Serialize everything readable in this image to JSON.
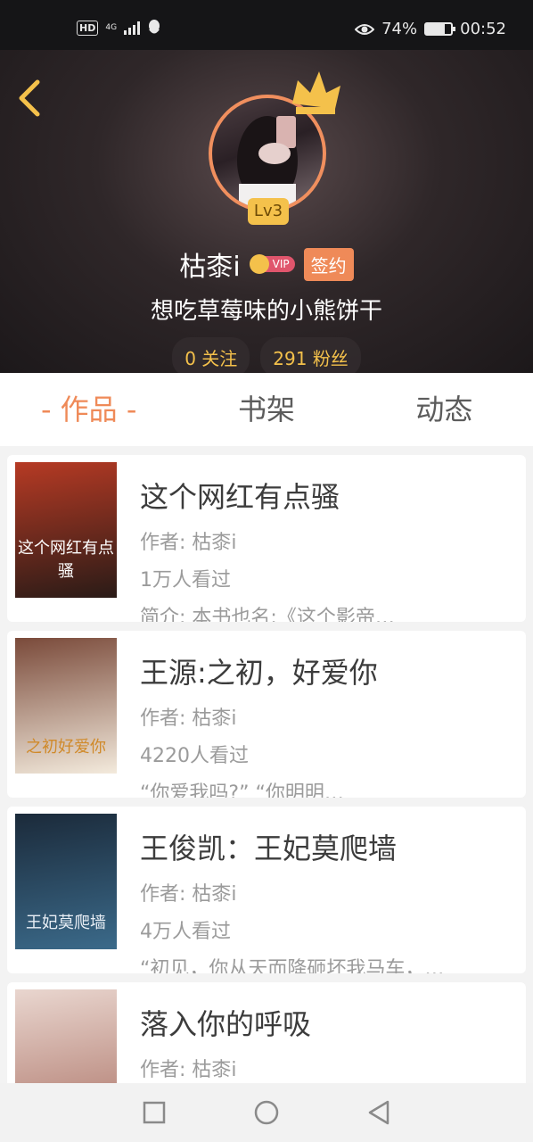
{
  "status_bar": {
    "hd": "HD",
    "network": "4G",
    "battery_percent": "74%",
    "battery_level": 74,
    "time": "00:52"
  },
  "profile": {
    "level": "Lv3",
    "name": "枯桼i",
    "vip_label": "VIP",
    "signed_label": "签约",
    "motto": "想吃草莓味的小熊饼干",
    "following": "0 关注",
    "followers": "291 粉丝"
  },
  "tabs": [
    {
      "label": "- 作品 -",
      "active": true
    },
    {
      "label": "书架",
      "active": false
    },
    {
      "label": "动态",
      "active": false
    }
  ],
  "books": [
    {
      "title": "这个网红有点骚",
      "author": "作者: 枯桼i",
      "views": "1万人看过",
      "summary": "简介: 本书也名:《这个影帝…",
      "cover_text": "这个网红有点骚",
      "cover_colors": [
        "#b63a24",
        "#2a1b17"
      ]
    },
    {
      "title": "王源:之初，好爱你",
      "author": "作者: 枯桼i",
      "views": "4220人看过",
      "summary": "“你爱我吗?” “你明明…",
      "cover_text": "之初好爱你",
      "cover_colors": [
        "#7a4a3a",
        "#f3eadc"
      ]
    },
    {
      "title": "王俊凯：王妃莫爬墙",
      "author": "作者: 枯桼i",
      "views": "4万人看过",
      "summary": "“初见，你从天而降砸坏我马车，…",
      "cover_text": "王妃莫爬墙",
      "cover_colors": [
        "#1b2a3a",
        "#3b6a8a"
      ]
    },
    {
      "title": "落入你的呼吸",
      "author": "作者: 枯桼i",
      "views": "",
      "summary": "",
      "cover_text": "",
      "cover_colors": [
        "#e9d6cf",
        "#b07a6e"
      ]
    }
  ],
  "colors": {
    "accent": "#ef8a58",
    "gold": "#f4c14b"
  },
  "icons": {
    "back": "chevron-left-icon",
    "crown": "crown-icon",
    "eye": "eye-icon",
    "nav": [
      "square-icon",
      "circle-icon",
      "triangle-back-icon"
    ]
  }
}
